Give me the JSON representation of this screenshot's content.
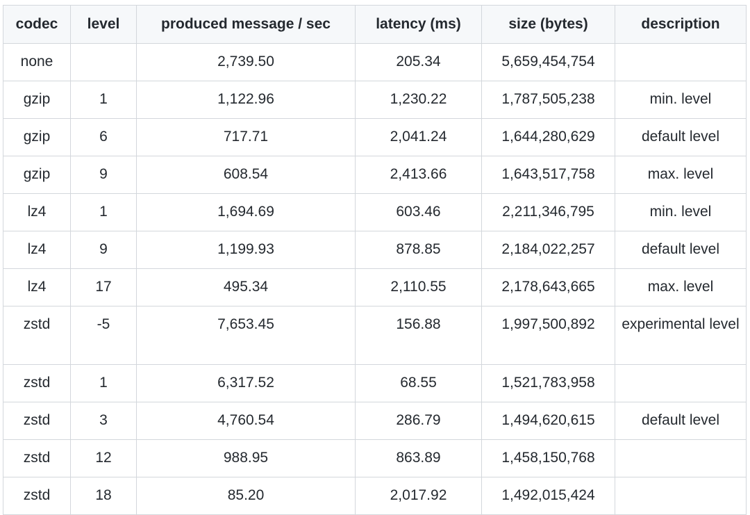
{
  "table": {
    "headers": [
      "codec",
      "level",
      "produced message / sec",
      "latency (ms)",
      "size (bytes)",
      "description"
    ],
    "rows": [
      [
        "none",
        "",
        "2,739.50",
        "205.34",
        "5,659,454,754",
        ""
      ],
      [
        "gzip",
        "1",
        "1,122.96",
        "1,230.22",
        "1,787,505,238",
        "min. level"
      ],
      [
        "gzip",
        "6",
        "717.71",
        "2,041.24",
        "1,644,280,629",
        "default level"
      ],
      [
        "gzip",
        "9",
        "608.54",
        "2,413.66",
        "1,643,517,758",
        "max. level"
      ],
      [
        "lz4",
        "1",
        "1,694.69",
        "603.46",
        "2,211,346,795",
        "min. level"
      ],
      [
        "lz4",
        "9",
        "1,199.93",
        "878.85",
        "2,184,022,257",
        "default level"
      ],
      [
        "lz4",
        "17",
        "495.34",
        "2,110.55",
        "2,178,643,665",
        "max. level"
      ],
      [
        "zstd",
        "-5",
        "7,653.45",
        "156.88",
        "1,997,500,892",
        "experimental level"
      ],
      [
        "zstd",
        "1",
        "6,317.52",
        "68.55",
        "1,521,783,958",
        ""
      ],
      [
        "zstd",
        "3",
        "4,760.54",
        "286.79",
        "1,494,620,615",
        "default level"
      ],
      [
        "zstd",
        "12",
        "988.95",
        "863.89",
        "1,458,150,768",
        ""
      ],
      [
        "zstd",
        "18",
        "85.20",
        "2,017.92",
        "1,492,015,424",
        ""
      ]
    ]
  }
}
